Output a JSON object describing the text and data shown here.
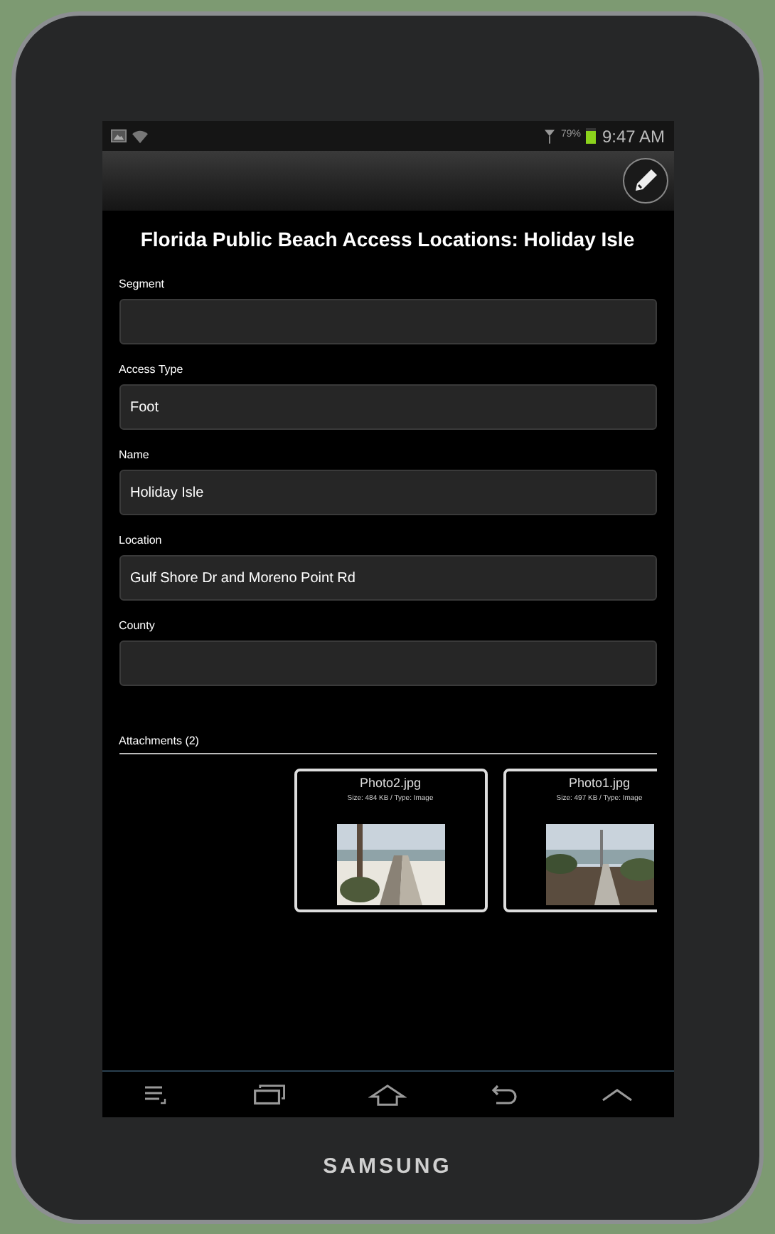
{
  "status_bar": {
    "battery_percent": "79%",
    "time": "9:47 AM",
    "battery": {
      "level": 0.79
    }
  },
  "form": {
    "title": "Florida Public Beach Access Locations: Holiday Isle",
    "fields": [
      {
        "label": "Segment"
      },
      {
        "label": "Access Type",
        "value": "Foot"
      },
      {
        "label": "Name",
        "value": "Holiday Isle"
      },
      {
        "label": "Location",
        "value": "Gulf Shore Dr and Moreno Point Rd"
      },
      {
        "label": "County"
      }
    ]
  },
  "attachments": {
    "heading": "Attachments (2)",
    "items": [
      {
        "name": "Photo2.jpg",
        "info": "Size: 484 KB / Type: Image",
        "kind": "picture"
      },
      {
        "name": "Photo1.jpg",
        "info": "Size: 497 KB / Type: Image",
        "kind": "picture"
      }
    ]
  },
  "device": {
    "brand": "SAMSUNG"
  }
}
